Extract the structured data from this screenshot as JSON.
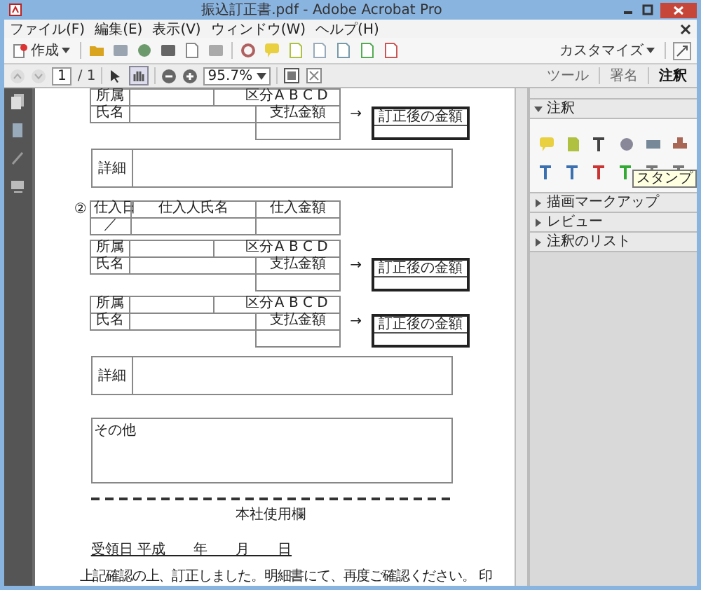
{
  "window": {
    "title": "振込訂正書.pdf - Adobe Acrobat Pro"
  },
  "menu": [
    "ファイル(F)",
    "編集(E)",
    "表示(V)",
    "ウィンドウ(W)",
    "ヘルプ(H)"
  ],
  "toolbar": {
    "create": "作成",
    "customize": "カスタマイズ"
  },
  "nav": {
    "page": "1",
    "total": "/ 1",
    "zoom": "95.7%"
  },
  "task_tabs": [
    {
      "label": "ツール",
      "selected": false
    },
    {
      "label": "署名",
      "selected": false
    },
    {
      "label": "注釈",
      "selected": true
    }
  ],
  "panel": {
    "sections": [
      {
        "label": "注釈",
        "expanded": true
      },
      {
        "label": "描画マークアップ",
        "expanded": false
      },
      {
        "label": "レビュー",
        "expanded": false
      },
      {
        "label": "注釈のリスト",
        "expanded": false
      }
    ],
    "tooltip": "スタンプ"
  },
  "document": {
    "blocks": [
      {
        "kind": "person",
        "dept": "所属",
        "category": "区分",
        "options": "A B C D",
        "name": "氏名",
        "payment": "支払金額",
        "arrow": "→",
        "corrected": "訂正後の金額"
      },
      {
        "kind": "detail",
        "label": "詳細"
      },
      {
        "kind": "purchase",
        "number": "②",
        "headers": [
          "仕入日",
          "仕入人氏名",
          "仕入金額"
        ],
        "date_mark": "／"
      },
      {
        "kind": "person",
        "dept": "所属",
        "category": "区分",
        "options": "A B C D",
        "name": "氏名",
        "payment": "支払金額",
        "arrow": "→",
        "corrected": "訂正後の金額"
      },
      {
        "kind": "person",
        "dept": "所属",
        "category": "区分",
        "options": "A B C D",
        "name": "氏名",
        "payment": "支払金額",
        "arrow": "→",
        "corrected": "訂正後の金額"
      },
      {
        "kind": "detail",
        "label": "詳細"
      },
      {
        "kind": "other",
        "label": "その他"
      }
    ],
    "office_use": "本社使用欄",
    "received": "受領日 平成　　年　　月　　日",
    "note": "上記確認の上、訂正しました。明細書にて、再度ご確認ください。 印"
  }
}
